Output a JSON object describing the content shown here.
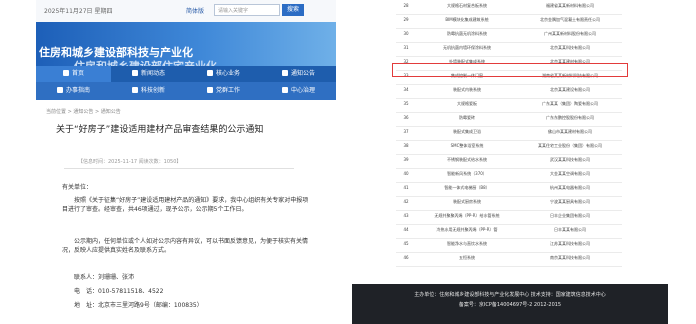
{
  "left": {
    "topbar": {
      "date": "2025年11月27日 星期四",
      "link": "简体版",
      "search_placeholder": "请输入关键字",
      "search_button": "搜索"
    },
    "banner": {
      "line1": "住房和城乡建设部科技与产业化",
      "line2": "住房和城乡建设部住宅产业化"
    },
    "nav_row1": [
      "首页",
      "新闻动态",
      "核心业务",
      "通知公告"
    ],
    "nav_row2": [
      "办事指南",
      "科技创新",
      "党群工作",
      "中心治理"
    ],
    "breadcrumb": "当前位置 > 通知公告 > 通知公告",
    "article": {
      "title": "关于“好房子”建设适用建材产品审查结果的公示通知",
      "meta": "【信息时间：2025-11-17  阅读次数：1050】",
      "salutation": "有关单位：",
      "p1": "按照《关于征集“好房子”建设适用建材产品的通知》要求，我中心组织有关专家对申报项目进行了审查。经审查，共46项通过，现予公示，公示期5个工作日。",
      "p2": "公示期内，任何单位或个人如对公示内容有异议，可以书面反馈意见，为便于核实有关情况，反映人应提供真实姓名及联系方式。",
      "contact_label": "联系人：",
      "contact": "刘珊珊、张沛",
      "phone_label": "电　话：",
      "phone": "010-57811518、4522",
      "address_label": "地　址：",
      "address": "北京市三里河路9号（邮编：100835）"
    }
  },
  "right": {
    "rows": [
      {
        "num": "28",
        "name": "大规格石材复合板系统",
        "company": "福建省某某新材料有限公司"
      },
      {
        "num": "29",
        "name": "BIM模块化集成建筑系统",
        "company": "北京金隅加气混凝土有限责任公司"
      },
      {
        "num": "30",
        "name": "防霉抗菌无机涂料系统",
        "company": "广州某某新材料股份有限公司"
      },
      {
        "num": "31",
        "name": "无机抗菌内墙环保涂料系统",
        "company": "北京某某科技有限公司"
      },
      {
        "num": "32",
        "name": "外墙装配式集成系统",
        "company": "北京某某建材有限公司"
      },
      {
        "num": "33",
        "name": "集成控制一体门窗",
        "company": "湖南省某某新材料科技有限公司"
      },
      {
        "num": "34",
        "name": "装配式内装系统",
        "company": "北京某某建设有限公司"
      },
      {
        "num": "35",
        "name": "大规格瓷板",
        "company": "广东某某（集团）陶瓷有限公司"
      },
      {
        "num": "36",
        "name": "防霉瓷砖",
        "company": "广东东鹏控股股份有限公司"
      },
      {
        "num": "37",
        "name": "装配式集成卫浴",
        "company": "佛山市某某建材有限公司"
      },
      {
        "num": "38",
        "name": "SMC整体浴室系统",
        "company": "某某住宅工业股份（集团）有限公司"
      },
      {
        "num": "39",
        "name": "不锈钢装配式给水系统",
        "company": "武汉某某科技有限公司"
      },
      {
        "num": "40",
        "name": "智能新风系统（370）",
        "company": "大金某某空调有限公司"
      },
      {
        "num": "41",
        "name": "智能一体式电梯厨（B8）",
        "company": "杭州某某电器有限公司"
      },
      {
        "num": "42",
        "name": "装配式厨房系统",
        "company": "宁波某某厨具有限公司"
      },
      {
        "num": "43",
        "name": "无规共聚聚丙烯（PP-R）给水管系统",
        "company": "日丰企业集团有限公司"
      },
      {
        "num": "44",
        "name": "冷热水用无规共聚丙烯（PP-R）管",
        "company": "日丰某某有限公司"
      },
      {
        "num": "45",
        "name": "智能净水与直饮水系统",
        "company": "江苏某某科技有限公司"
      },
      {
        "num": "46",
        "name": "五恒系统",
        "company": "南京某某科技有限公司"
      }
    ],
    "footer": {
      "line1": "主办单位：住房和城乡建设部科技与产业化发展中心  技术支持：国家建筑信息技术中心",
      "line2": "备案号：京ICP备14004697号-2  2012-2015"
    }
  },
  "colors": {
    "nav_dark": "#1e5dad",
    "nav_light": "#2f6fc2",
    "highlight": "#e23b3b",
    "footer": "#1f2227"
  }
}
